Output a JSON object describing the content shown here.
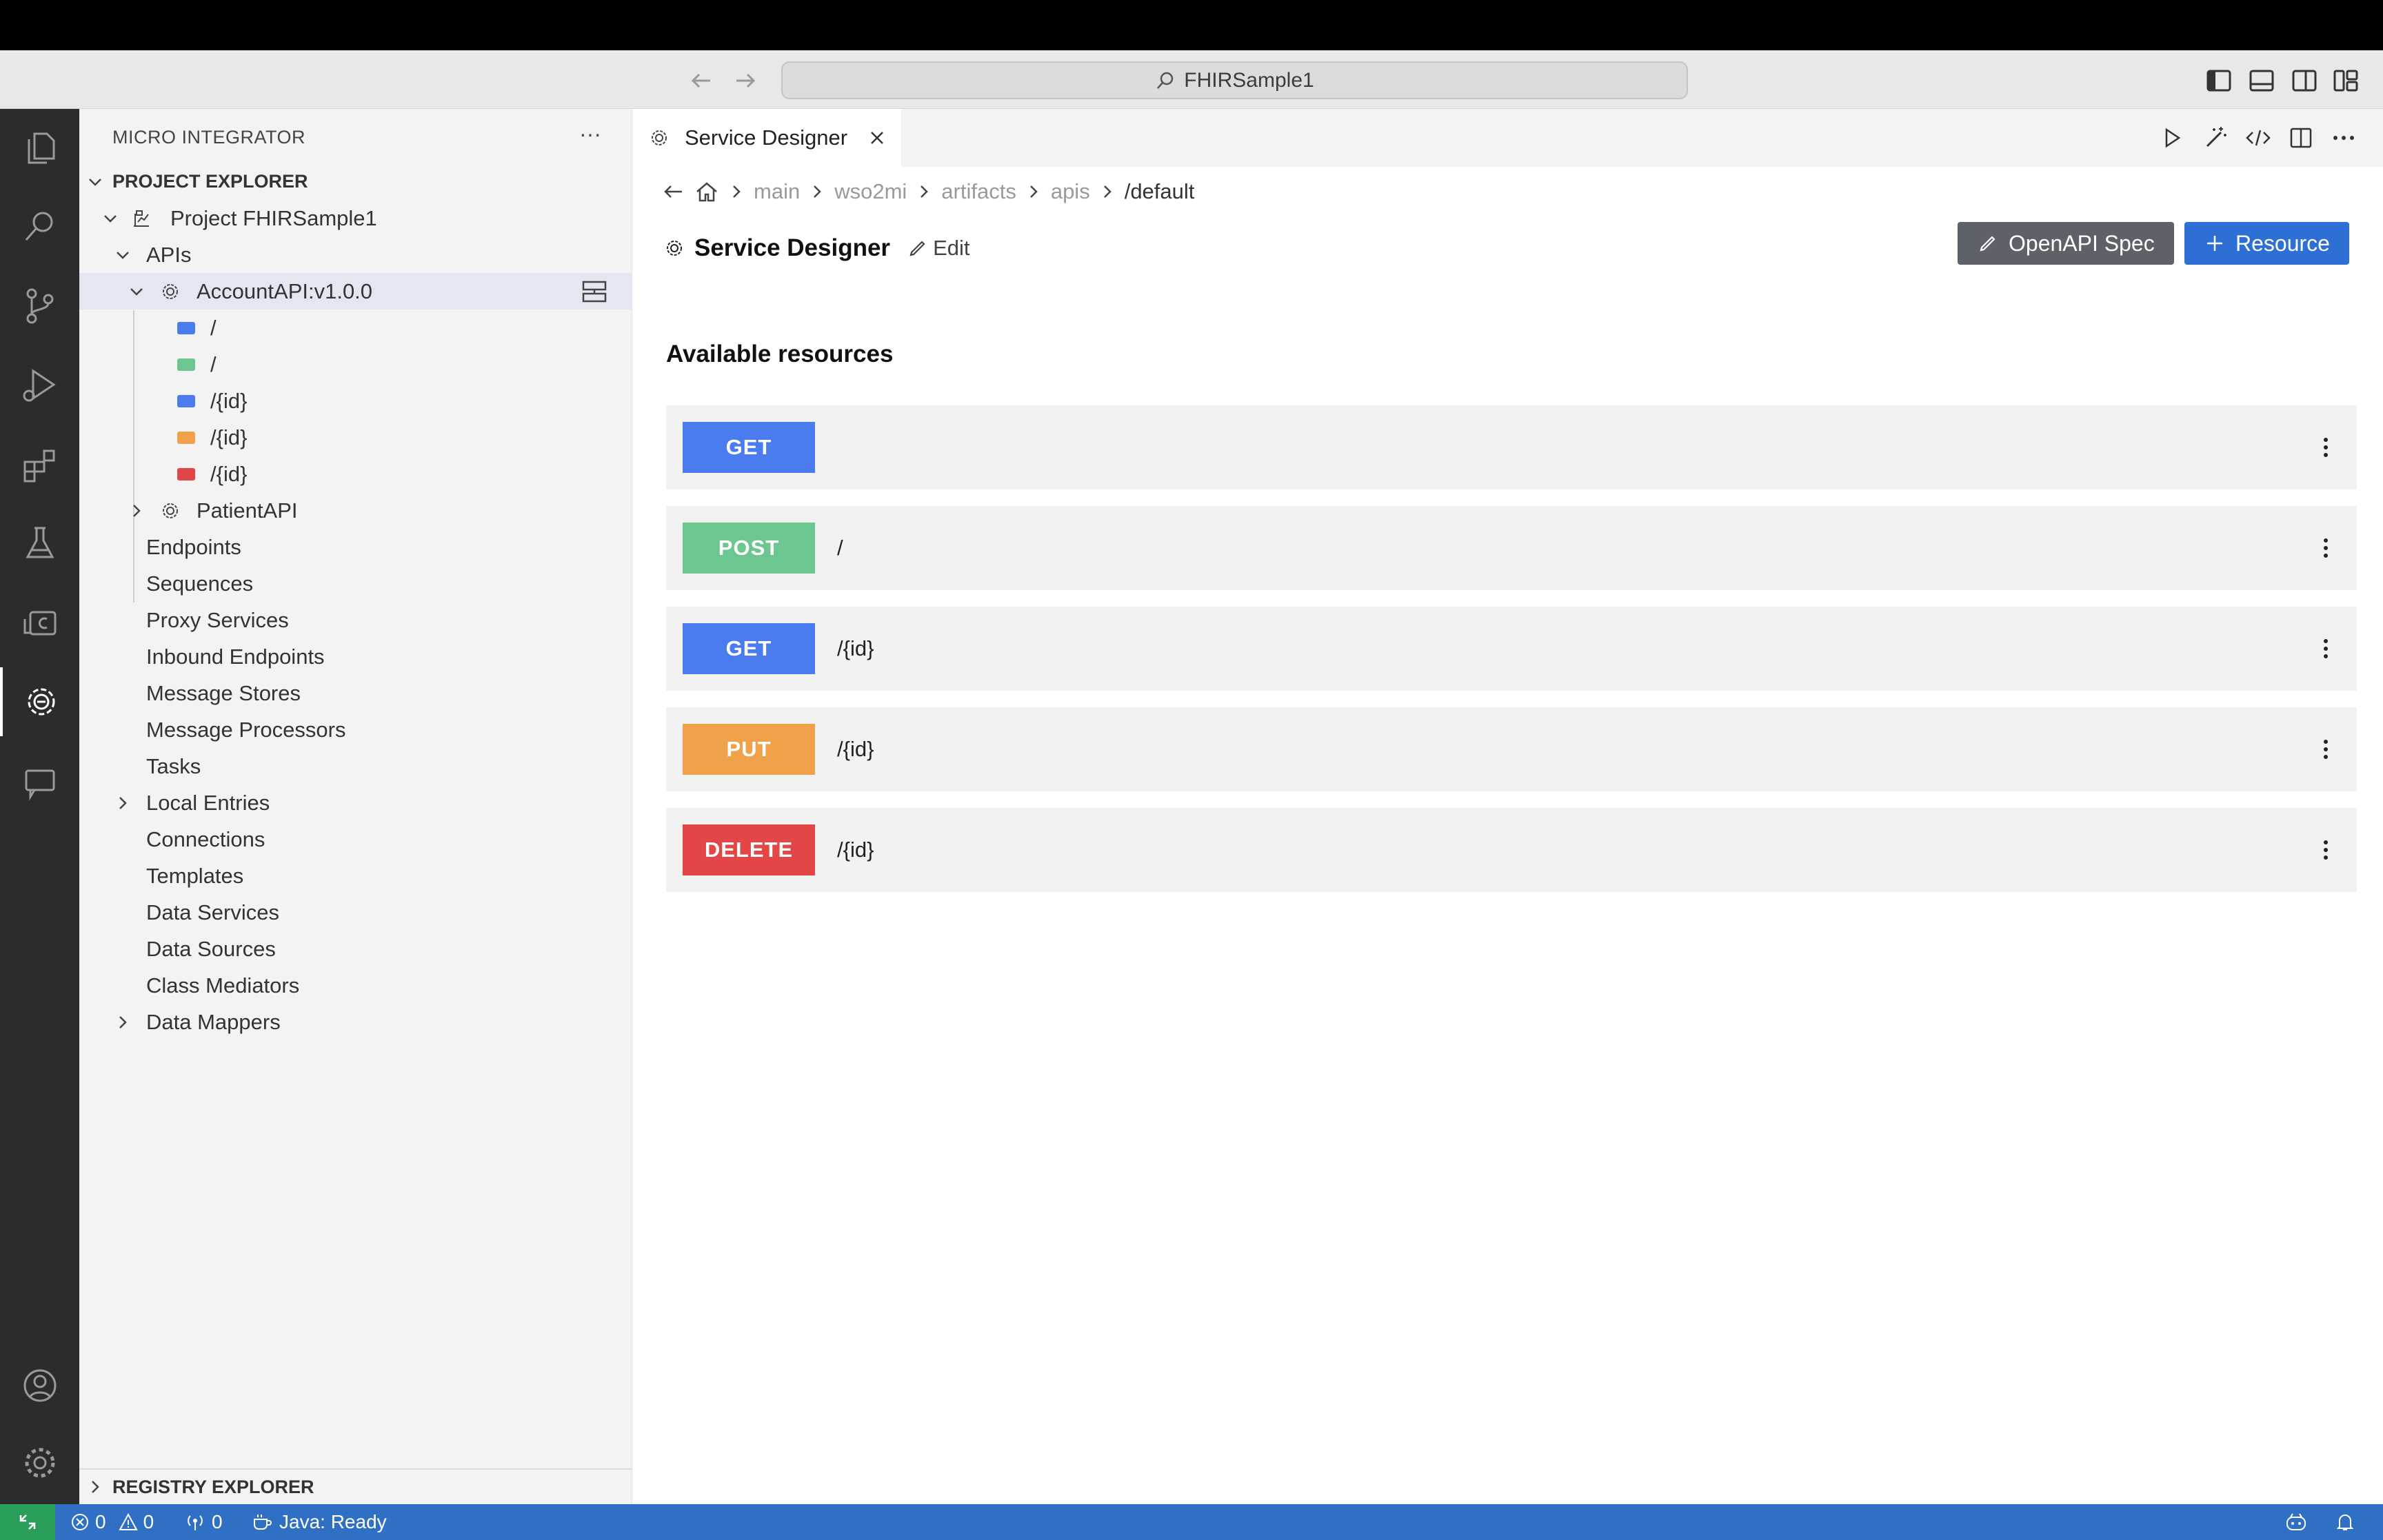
{
  "window": {
    "search_text": "FHIRSample1"
  },
  "sidebar": {
    "title": "MICRO INTEGRATOR",
    "more": "···",
    "project_explorer": "PROJECT EXPLORER",
    "project": "Project FHIRSample1",
    "apis": "APIs",
    "account_api": "AccountAPI:v1.0.0",
    "account_resources": [
      {
        "path": "/",
        "color": "#4a7cf0"
      },
      {
        "path": "/",
        "color": "#6cc68f"
      },
      {
        "path": "/{id}",
        "color": "#4a7cf0"
      },
      {
        "path": "/{id}",
        "color": "#f0a24a"
      },
      {
        "path": "/{id}",
        "color": "#e24646"
      }
    ],
    "patient_api": "PatientAPI",
    "items": [
      "Endpoints",
      "Sequences",
      "Proxy Services",
      "Inbound Endpoints",
      "Message Stores",
      "Message Processors",
      "Tasks",
      "Local Entries",
      "Connections",
      "Templates",
      "Data Services",
      "Data Sources",
      "Class Mediators",
      "Data Mappers"
    ],
    "registry_explorer": "REGISTRY EXPLORER"
  },
  "editor": {
    "tab_label": "Service Designer",
    "breadcrumb": [
      "main",
      "wso2mi",
      "artifacts",
      "apis"
    ],
    "breadcrumb_last": "/default",
    "title": "Service Designer",
    "edit_label": "Edit",
    "openapi_label": "OpenAPI Spec",
    "resource_label": "Resource",
    "section_title": "Available resources",
    "resources": [
      {
        "method": "GET",
        "path": "",
        "color": "#4a7cf0"
      },
      {
        "method": "POST",
        "path": "/",
        "color": "#6cc68f"
      },
      {
        "method": "GET",
        "path": "/{id}",
        "color": "#4a7cf0"
      },
      {
        "method": "PUT",
        "path": "/{id}",
        "color": "#f0a24a"
      },
      {
        "method": "DELETE",
        "path": "/{id}",
        "color": "#e24646"
      }
    ]
  },
  "statusbar": {
    "errors": "0",
    "warnings": "0",
    "ports": "0",
    "java": "Java: Ready"
  },
  "colors": {
    "accent": "#2d6fd4",
    "statusbar": "#2f6fc4",
    "remote": "#2a9f5c"
  }
}
